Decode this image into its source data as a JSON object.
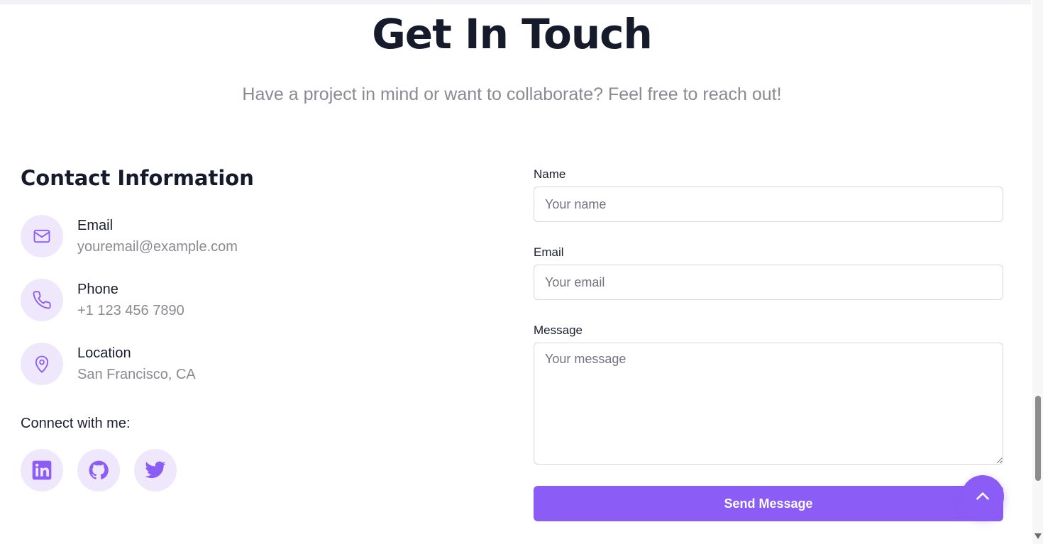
{
  "header": {
    "title": "Get In Touch",
    "subtitle": "Have a project in mind or want to collaborate? Feel free to reach out!"
  },
  "contact": {
    "heading": "Contact Information",
    "items": [
      {
        "label": "Email",
        "value": "youremail@example.com",
        "icon": "mail-icon"
      },
      {
        "label": "Phone",
        "value": "+1 123 456 7890",
        "icon": "phone-icon"
      },
      {
        "label": "Location",
        "value": "San Francisco, CA",
        "icon": "map-pin-icon"
      }
    ],
    "connect_label": "Connect with me:",
    "socials": [
      "linkedin-icon",
      "github-icon",
      "twitter-icon"
    ]
  },
  "form": {
    "name_label": "Name",
    "name_placeholder": "Your name",
    "email_label": "Email",
    "email_placeholder": "Your email",
    "message_label": "Message",
    "message_placeholder": "Your message",
    "submit_label": "Send Message"
  },
  "colors": {
    "accent": "#8b5cf6",
    "icon_bg": "#efe8fd",
    "muted_text": "#8a8a93",
    "heading_text": "#161b2b"
  }
}
